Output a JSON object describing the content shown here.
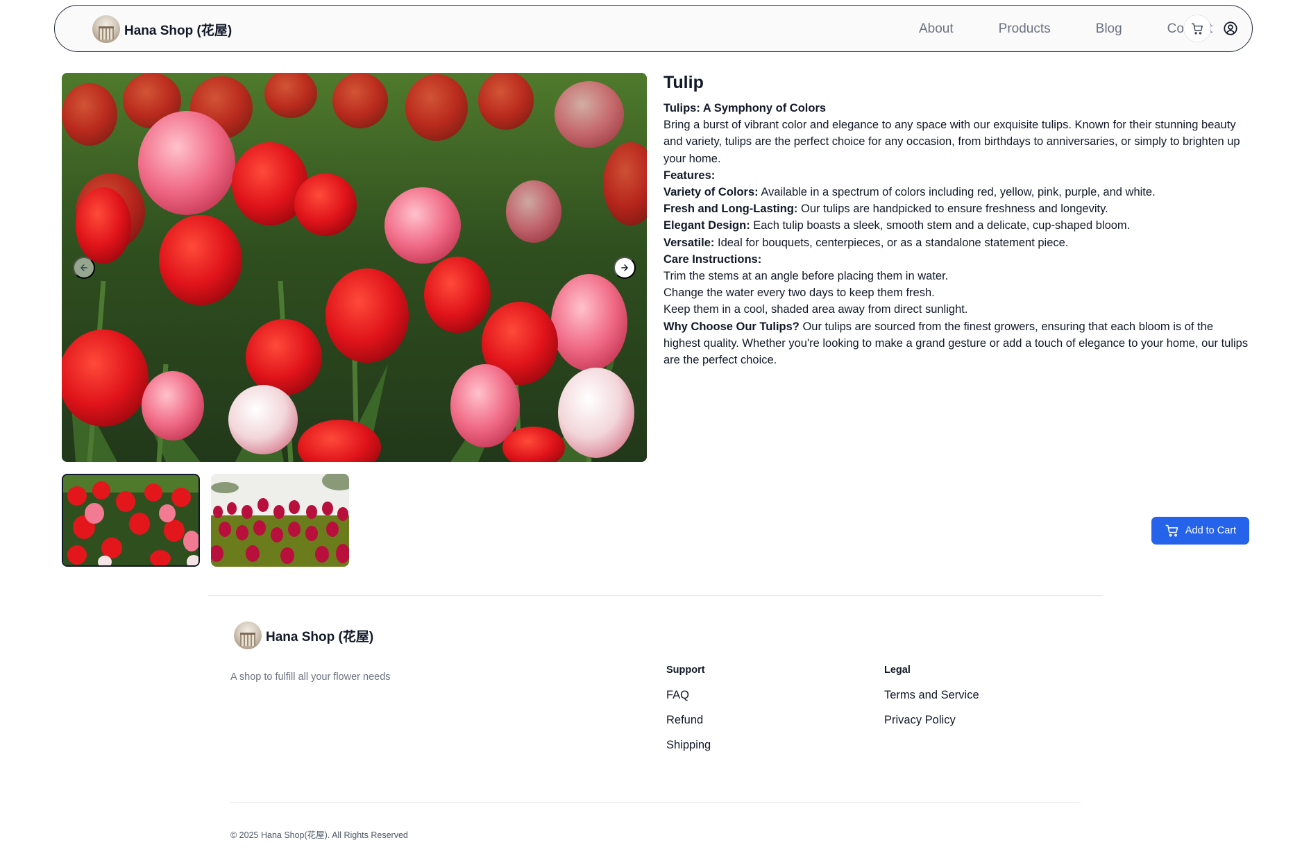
{
  "brand": {
    "name": "Hana Shop (花屋)"
  },
  "nav": {
    "links": [
      "About",
      "Products",
      "Blog",
      "Contact"
    ],
    "cart_icon": "cart-icon",
    "user_icon": "user-circle-icon"
  },
  "gallery": {
    "prev_icon": "arrow-left-icon",
    "next_icon": "arrow-right-icon",
    "thumbnail_count": 2
  },
  "product": {
    "title": "Tulip",
    "subtitle": "Tulips: A Symphony of Colors",
    "intro": "Bring a burst of vibrant color and elegance to any space with our exquisite tulips. Known for their stunning beauty and variety, tulips are the perfect choice for any occasion, from birthdays to anniversaries, or simply to brighten up your home.",
    "features_heading": "Features:",
    "features": [
      {
        "label": "Variety of Colors:",
        "text": "Available in a spectrum of colors including red, yellow, pink, purple, and white."
      },
      {
        "label": "Fresh and Long-Lasting:",
        "text": "Our tulips are handpicked to ensure freshness and longevity."
      },
      {
        "label": "Elegant Design:",
        "text": "Each tulip boasts a sleek, smooth stem and a delicate, cup-shaped bloom."
      },
      {
        "label": "Versatile:",
        "text": "Ideal for bouquets, centerpieces, or as a standalone statement piece."
      }
    ],
    "care_heading": "Care Instructions:",
    "care": [
      "Trim the stems at an angle before placing them in water.",
      "Change the water every two days to keep them fresh.",
      "Keep them in a cool, shaded area away from direct sunlight."
    ],
    "why_label": "Why Choose Our Tulips?",
    "why_text": "Our tulips are sourced from the finest growers, ensuring that each bloom is of the highest quality. Whether you're looking to make a grand gesture or add a touch of elegance to your home, our tulips are the perfect choice.",
    "add_to_cart": "Add to Cart"
  },
  "footer": {
    "brand_name": "Hana Shop (花屋)",
    "tagline": "A shop to fulfill all your flower needs",
    "support_title": "Support",
    "support_links": [
      "FAQ",
      "Refund",
      "Shipping"
    ],
    "legal_title": "Legal",
    "legal_links": [
      "Terms and Service",
      "Privacy Policy"
    ],
    "copyright": "© 2025 Hana Shop(花屋). All Rights Reserved"
  },
  "colors": {
    "accent": "#2563eb",
    "text": "#111827",
    "muted": "#6b7280"
  }
}
